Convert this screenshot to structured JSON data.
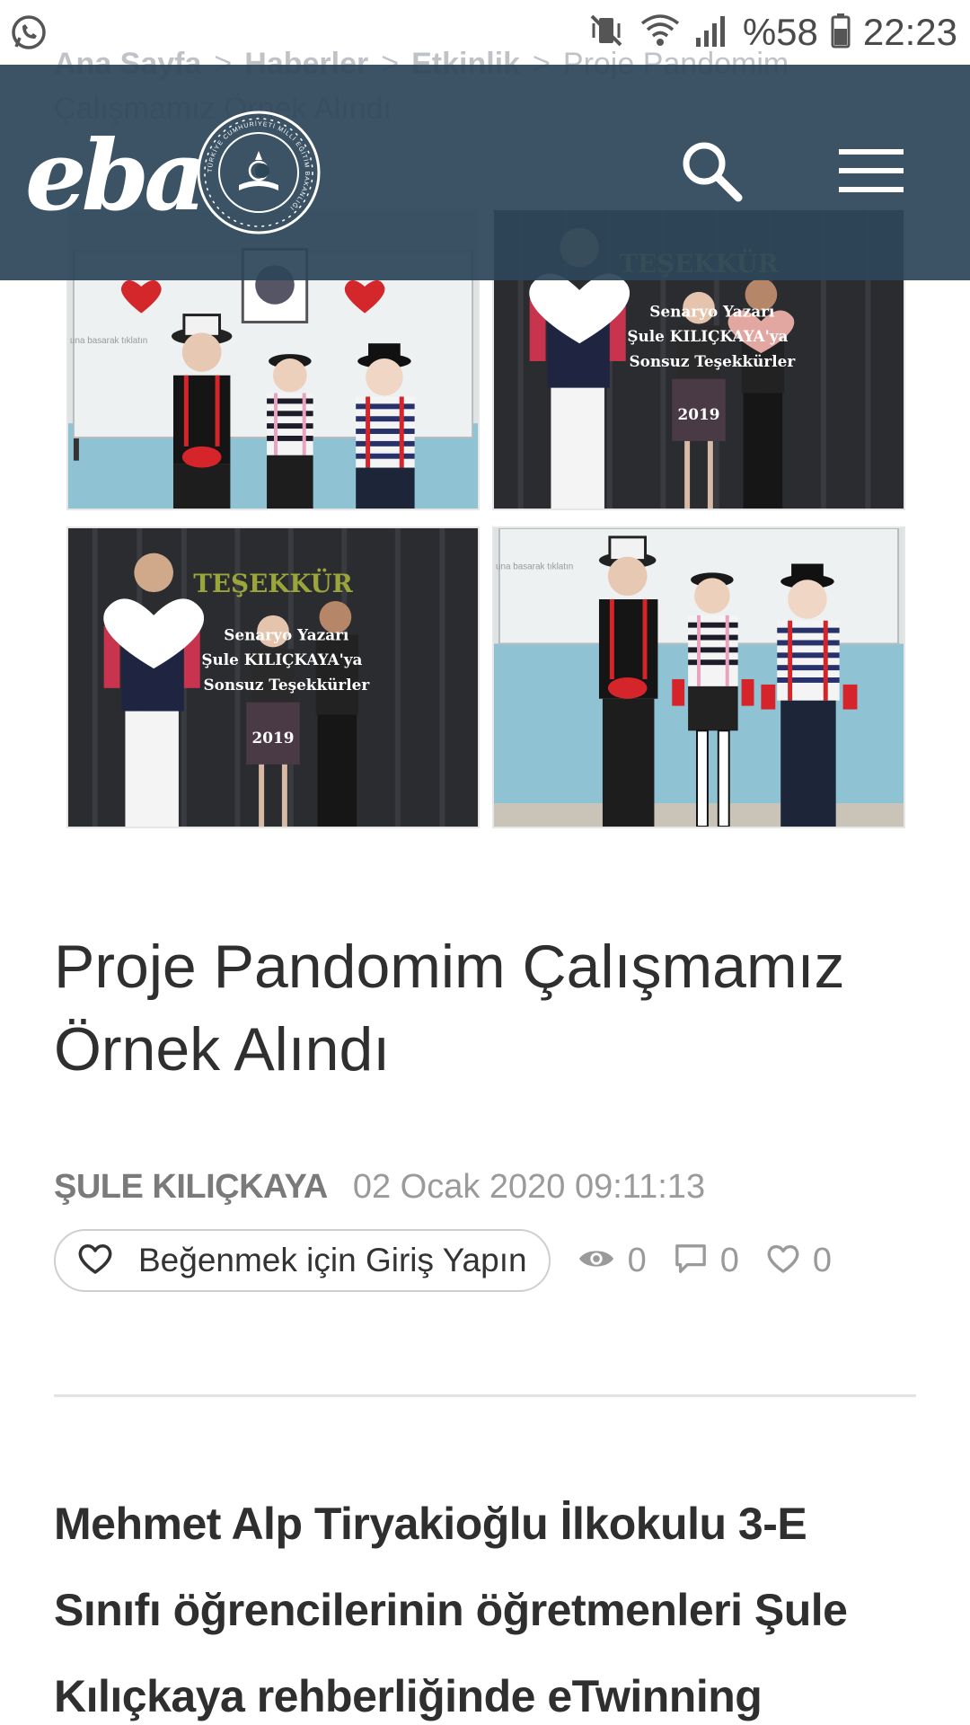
{
  "status_bar": {
    "battery": "%58",
    "time": "22:23"
  },
  "breadcrumb": {
    "items": [
      "Ana Sayfa",
      "Haberler",
      "Etkinlik"
    ],
    "current": "Proje Pandomim Çalışmamız Örnek Alındı"
  },
  "header": {
    "logo_text": "eba",
    "seal_text": "TÜRKİYE CUMHURİYETİ MİLLİ EĞİTİM BAKANLIĞI"
  },
  "photos": {
    "slide_tesekkur": "TEŞEKKÜR",
    "slide_line1": "Senaryo Yazarı",
    "slide_line2": "Şule KILIÇKAYA'ya",
    "slide_line3": "Sonsuz Teşekkürler",
    "slide_year": "2019",
    "board_caption": "una basarak tıklatın"
  },
  "article": {
    "title": "Proje Pandomim Çalışmamız Örnek Alındı",
    "author": "ŞULE KILIÇKAYA",
    "date": "02 Ocak 2020 09:11:13",
    "like_login_label": "Beğenmek için Giriş Yapın",
    "views": "0",
    "comments": "0",
    "likes": "0",
    "body": "Mehmet Alp Tiryakioğlu İlkokulu 3-E Sınıfı öğrencilerinin öğretmenleri Şule Kılıçkaya rehberliğinde eTwinning"
  },
  "icons": {
    "status_left": "whatsapp-icon",
    "status_right": [
      "mute-vibrate-icon",
      "wifi-icon",
      "signal-icon",
      "battery-icon"
    ],
    "header": [
      "search-icon",
      "hamburger-menu-icon"
    ],
    "stats": [
      "eye-icon",
      "comment-icon",
      "heart-icon"
    ]
  },
  "colors": {
    "header_bg": "#2c4658",
    "text_dark": "#2f2f2f",
    "meta_gray": "#9a9a9a"
  }
}
